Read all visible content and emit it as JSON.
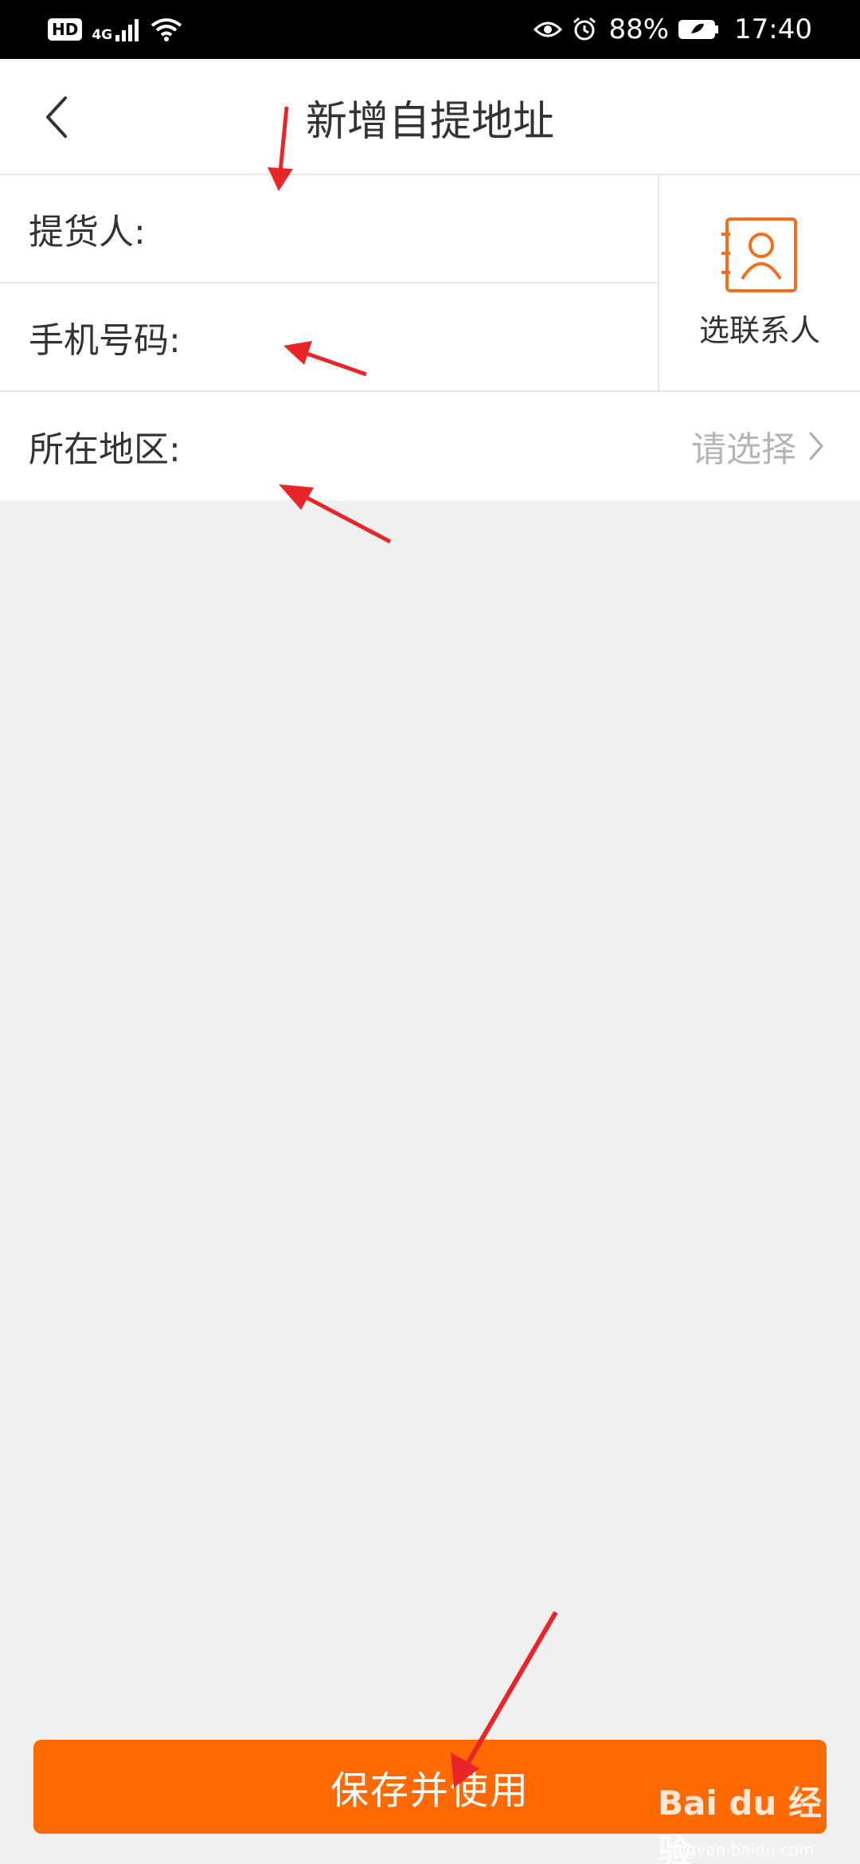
{
  "status_bar": {
    "hd": "HD",
    "network": "4G",
    "battery_percent": "88%",
    "time": "17:40",
    "icons": [
      "signal-icon",
      "wifi-icon",
      "eye-icon",
      "alarm-icon",
      "battery-icon"
    ]
  },
  "header": {
    "title": "新增自提地址",
    "back_icon": "chevron-left-icon"
  },
  "form": {
    "consignee_label": "提货人:",
    "consignee_value": "",
    "phone_label": "手机号码:",
    "phone_value": "",
    "region_label": "所在地区:",
    "region_placeholder": "请选择",
    "contact_button_label": "选联系人"
  },
  "footer": {
    "save_label": "保存并使用"
  },
  "watermark": {
    "brand": "Bai du 经验",
    "url": "jingyan.baidu.com"
  },
  "colors": {
    "accent": "#ff6a00",
    "contact_icon": "#f07020",
    "annotation_arrow": "#e8262a",
    "background": "#f0f0f0"
  }
}
